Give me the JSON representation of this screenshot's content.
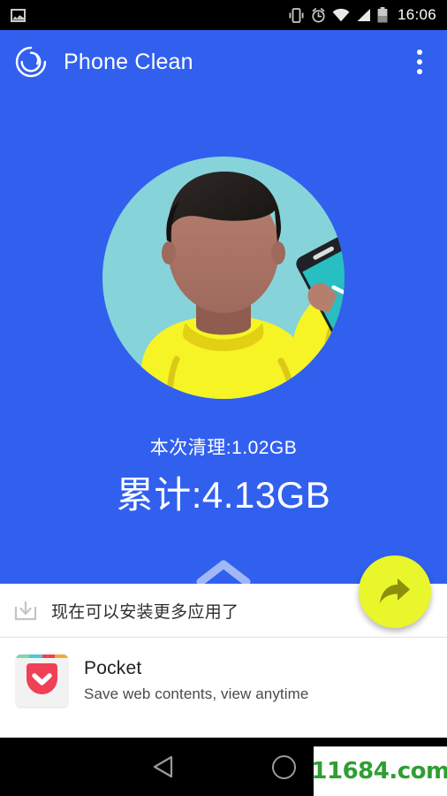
{
  "statusbar": {
    "icons_left": [
      "image-icon"
    ],
    "icons_right": [
      "vibrate-icon",
      "alarm-icon",
      "wifi-icon",
      "signal-icon",
      "battery-icon"
    ],
    "time": "16:06"
  },
  "appbar": {
    "logo": "swirl-logo-icon",
    "title": "Phone Clean",
    "overflow": "overflow-menu-icon"
  },
  "hero": {
    "illustration": "person-holding-phone-illustration",
    "cleaned_label": "本次清理:1.02GB",
    "total_label": "累计:4.13GB",
    "expand_hint": "chevron-up-icon",
    "background_color": "#3160ef"
  },
  "fab": {
    "icon": "share-arrow-icon",
    "color": "#e8f62b"
  },
  "promo": {
    "icon": "install-download-icon",
    "text": "现在可以安装更多应用了"
  },
  "apps": [
    {
      "icon": "pocket-app-icon",
      "name": "Pocket",
      "desc": "Save web contents, view anytime",
      "accent": "#ef4056"
    }
  ],
  "navbar": {
    "back": "back-triangle-icon",
    "home": "home-circle-icon",
    "watermark": "11684.com"
  }
}
